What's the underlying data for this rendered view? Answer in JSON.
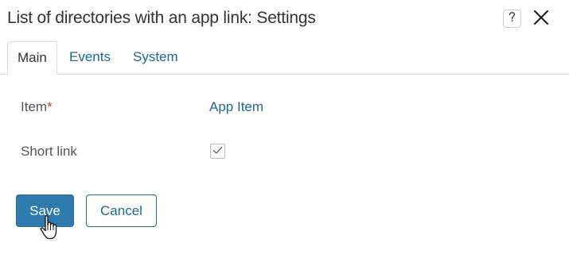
{
  "dialog": {
    "title": "List of directories with an app link: Settings",
    "help_icon": "question-icon",
    "close_icon": "close-icon"
  },
  "tabs": [
    {
      "label": "Main",
      "active": true
    },
    {
      "label": "Events",
      "active": false
    },
    {
      "label": "System",
      "active": false
    }
  ],
  "fields": {
    "item": {
      "label": "Item",
      "required_mark": "*",
      "value": "App Item"
    },
    "short_link": {
      "label": "Short link",
      "checked": true
    }
  },
  "buttons": {
    "save_label": "Save",
    "cancel_label": "Cancel"
  },
  "colors": {
    "accent": "#2f7bb0",
    "link": "#1e6796",
    "required": "#d43a3a"
  }
}
